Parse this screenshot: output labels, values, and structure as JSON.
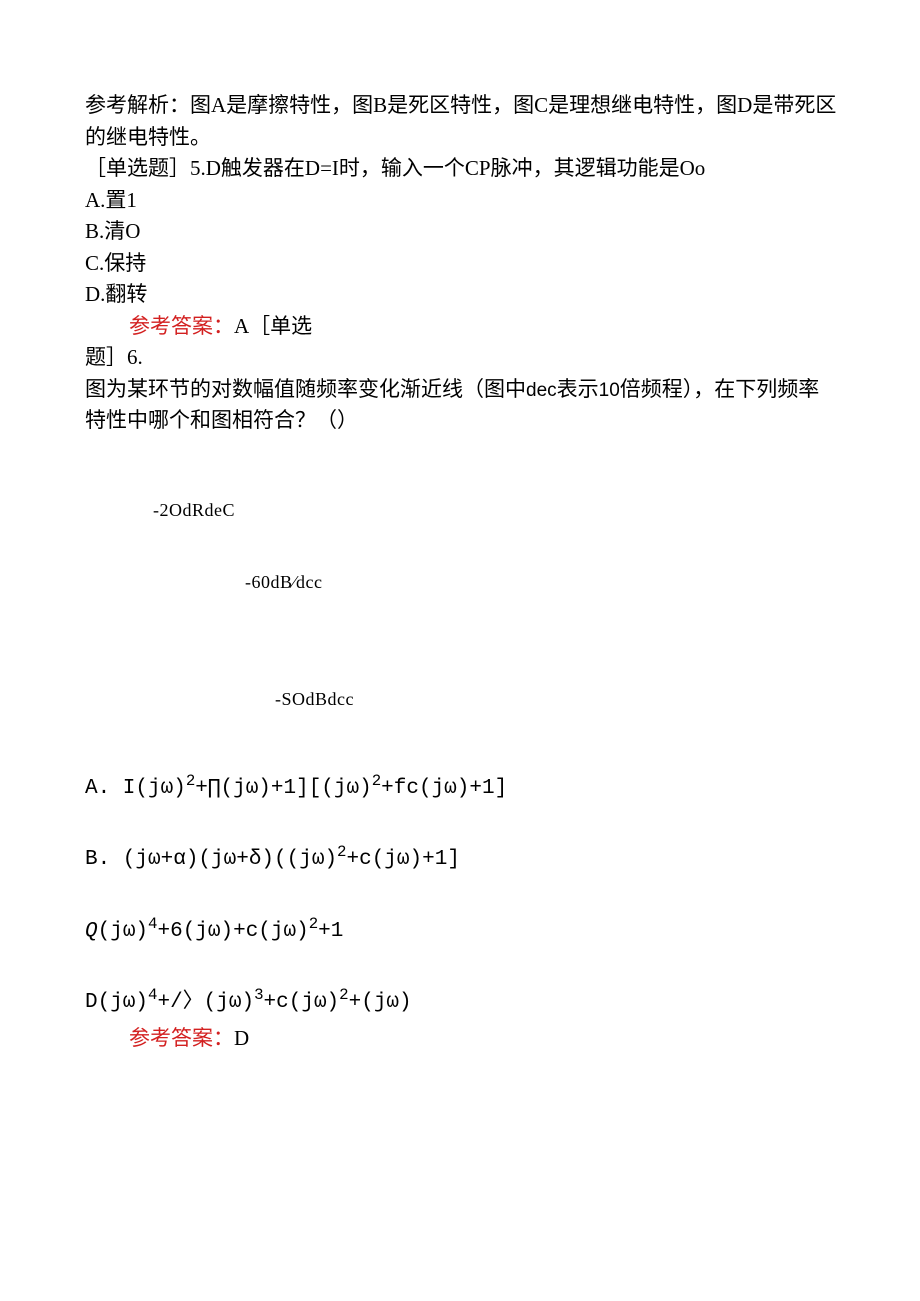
{
  "q4": {
    "explain_label": "参考解析：",
    "explain_text": "图A是摩擦特性，图B是死区特性，图C是理想继电特性，图D是带死区的继电特性。"
  },
  "q5": {
    "prefix": "［单选题］5.",
    "stem": "D触发器在D=I时，输入一个CP脉冲，其逻辑功能是Oo",
    "optA": "A.置1",
    "optB": "B.清O",
    "optC": "C.保持",
    "optD": "D.翻转",
    "answer_label": "参考答案：",
    "answer_value": "A",
    "suffix": "［单选"
  },
  "q6": {
    "prefix": "题］6.",
    "stem_a": "图为某环节的对数幅值随频率变化渐近线（图中",
    "stem_dec": "dec",
    "stem_b": "表示",
    "stem_10": "10",
    "stem_c": "倍频程），在下列频率特性中哪个和图相符合？（）",
    "diag1": "-2OdRdeC",
    "diag2": "-60dB⁄dcc",
    "diag3": "-SOdBdcc",
    "optA_prefix": "A.  I(jω)",
    "optA_exp2": "2",
    "optA_mid1": "+∏(jω)+1][(jω)",
    "optA_exp2b": "2",
    "optA_suffix": "+fc(jω)+1]",
    "optB_prefix": "B.  (jω+α)(jω+δ)((jω)",
    "optB_exp2": "2",
    "optB_suffix": "+c(jω)+1]",
    "optC_prefix_i": "Q",
    "optC_prefix": "(jω)",
    "optC_exp4": "4",
    "optC_mid1": "+6(jω)+c(jω)",
    "optC_exp2": "2",
    "optC_suffix": "+1",
    "optD_prefix": "D(jω)",
    "optD_exp4": "4",
    "optD_mid1": "+/〉(jω)",
    "optD_exp3": "3",
    "optD_mid2": "+c(jω)",
    "optD_exp2": "2",
    "optD_suffix": "+(jω)",
    "answer_label": "参考答案：",
    "answer_value": "D"
  }
}
